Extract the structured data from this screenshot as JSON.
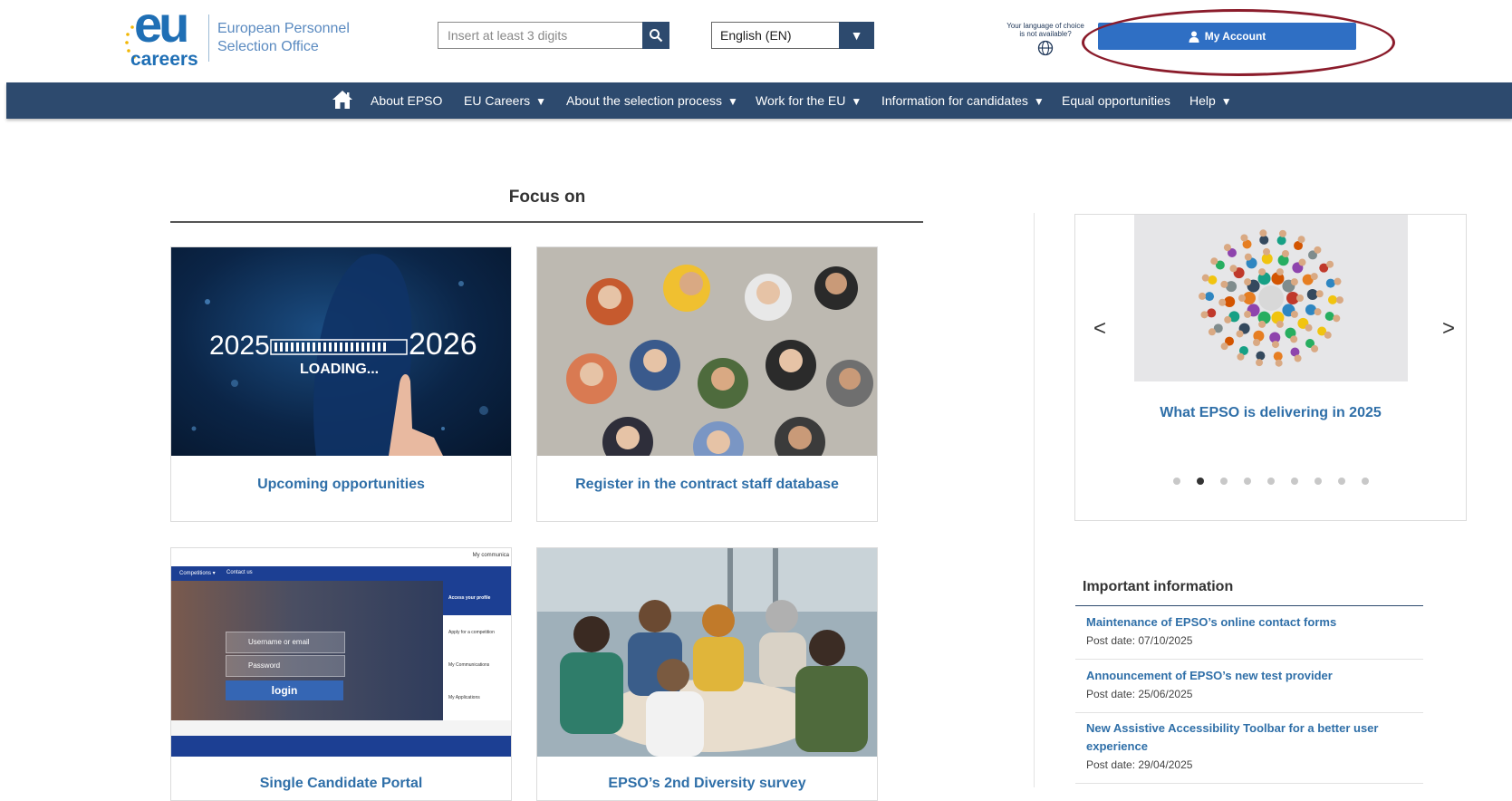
{
  "header": {
    "logo_mark": "eu",
    "logo_sub": "careers",
    "org_name_line1": "European Personnel",
    "org_name_line2": "Selection Office",
    "search_placeholder": "Insert at least 3 digits",
    "language_selected": "English (EN)",
    "language_note_line1": "Your language of choice",
    "language_note_line2": "is not available?",
    "account_label": "My Account"
  },
  "nav": {
    "items": [
      {
        "label": "About EPSO",
        "has_dropdown": false
      },
      {
        "label": "EU Careers",
        "has_dropdown": true
      },
      {
        "label": "About the selection process",
        "has_dropdown": true
      },
      {
        "label": "Work for the EU",
        "has_dropdown": true
      },
      {
        "label": "Information for candidates",
        "has_dropdown": true
      },
      {
        "label": "Equal opportunities",
        "has_dropdown": false
      },
      {
        "label": "Help",
        "has_dropdown": true
      }
    ],
    "dropdown_glyph": "▼"
  },
  "focus": {
    "title": "Focus on",
    "cards": [
      {
        "label": "Upcoming opportunities",
        "image_year_from": "2025",
        "image_year_to": "2026",
        "image_loading": "LOADING..."
      },
      {
        "label": "Register in the contract staff database"
      },
      {
        "label": "Single Candidate Portal",
        "image_tab1": "Competitions ▾",
        "image_tab2": "Contact us",
        "image_corner": "My communica",
        "image_menu": [
          "Access your profile",
          "Apply for a competition",
          "My Communications",
          "My Applications"
        ],
        "image_user": "Username or email",
        "image_pass": "Password",
        "image_login": "login"
      },
      {
        "label": "EPSO’s 2nd Diversity survey"
      }
    ]
  },
  "carousel": {
    "prev": "<",
    "next": ">",
    "caption": "What EPSO is delivering in 2025",
    "dot_count": 9,
    "active_dot": 2
  },
  "important_info": {
    "title": "Important information",
    "items": [
      {
        "title": "Maintenance of EPSO’s online contact forms",
        "date": "Post date: 07/10/2025"
      },
      {
        "title": "Announcement of EPSO’s new test provider",
        "date": "Post date: 25/06/2025"
      },
      {
        "title": "New Assistive Accessibility Toolbar for a better user experience",
        "date": "Post date: 29/04/2025"
      }
    ]
  },
  "colors": {
    "nav_bg": "#2d4a6e",
    "account_button": "#2f6fc4",
    "link_blue": "#2f6fa8",
    "highlight_ring": "#8b1c2b"
  }
}
